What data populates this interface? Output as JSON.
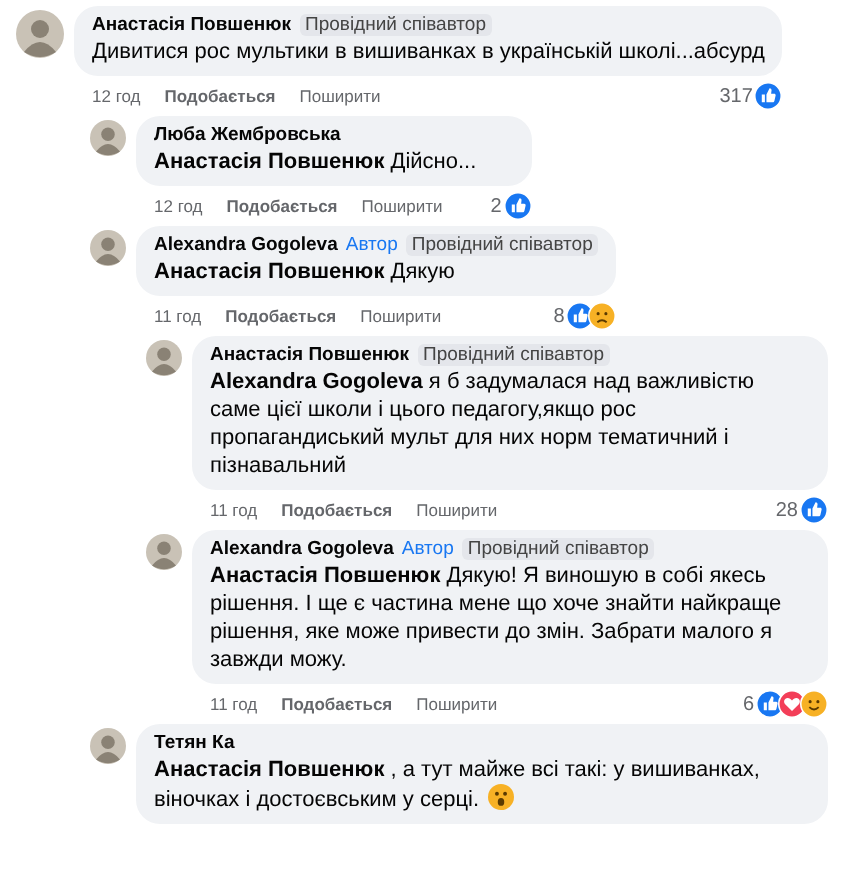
{
  "comments": [
    {
      "author": "Анастасія Повшенюк",
      "badges": [
        {
          "kind": "role",
          "label": "Провідний співавтор"
        }
      ],
      "text": "Дивитися рос мультики в вишиванках в українській школі...абсурд",
      "time": "12 год",
      "actions": [
        "Подобається",
        "Поширити"
      ],
      "reaction_count": "317",
      "reactions": [
        {
          "kind": "like"
        }
      ],
      "replies": [
        {
          "author": "Люба Жембровська",
          "text": "**Анастасія Повшенюк** Дійсно...",
          "time": "12 год",
          "actions": [
            "Подобається",
            "Поширити"
          ],
          "reaction_count": "2",
          "reactions": [
            {
              "kind": "like"
            }
          ]
        },
        {
          "author": "Alexandra Gogoleva",
          "badges": [
            {
              "kind": "author",
              "label": "Автор"
            },
            {
              "kind": "role",
              "label": "Провідний співавтор"
            }
          ],
          "text": "**Анастасія Повшенюк** Дякую",
          "time": "11 год",
          "actions": [
            "Подобається",
            "Поширити"
          ],
          "reaction_count": "8",
          "reactions": [
            {
              "kind": "like"
            },
            {
              "kind": "sad"
            }
          ],
          "replies": [
            {
              "author": "Анастасія Повшенюк",
              "badges": [
                {
                  "kind": "role",
                  "label": "Провідний співавтор"
                }
              ],
              "text": "**Alexandra Gogoleva** я б задумалася над важливістю саме цієї школи і цього педагогу,якщо рос пропагандиський мульт для них норм тематичний і пізнавальний",
              "time": "11 год",
              "actions": [
                "Подобається",
                "Поширити"
              ],
              "reaction_count": "28",
              "reactions": [
                {
                  "kind": "like"
                }
              ]
            },
            {
              "author": "Alexandra Gogoleva",
              "badges": [
                {
                  "kind": "author",
                  "label": "Автор"
                },
                {
                  "kind": "role",
                  "label": "Провідний співавтор"
                }
              ],
              "text": "**Анастасія Повшенюк** Дякую! Я виношую в собі якесь рішення. І ще є частина мене що хоче знайти найкраще рішення, яке може привести до змін. Забрати малого я завжди можу.",
              "time": "11 год",
              "actions": [
                "Подобається",
                "Поширити"
              ],
              "reaction_count": "6",
              "reactions": [
                {
                  "kind": "like"
                },
                {
                  "kind": "love"
                },
                {
                  "kind": "care"
                }
              ]
            }
          ]
        },
        {
          "author": "Тетян Ка",
          "text": "**Анастасія Повшенюк** , а тут майже всі такі: у вишиванках, віночках і достоєвським у серці.",
          "has_emoji": true
        }
      ]
    }
  ]
}
